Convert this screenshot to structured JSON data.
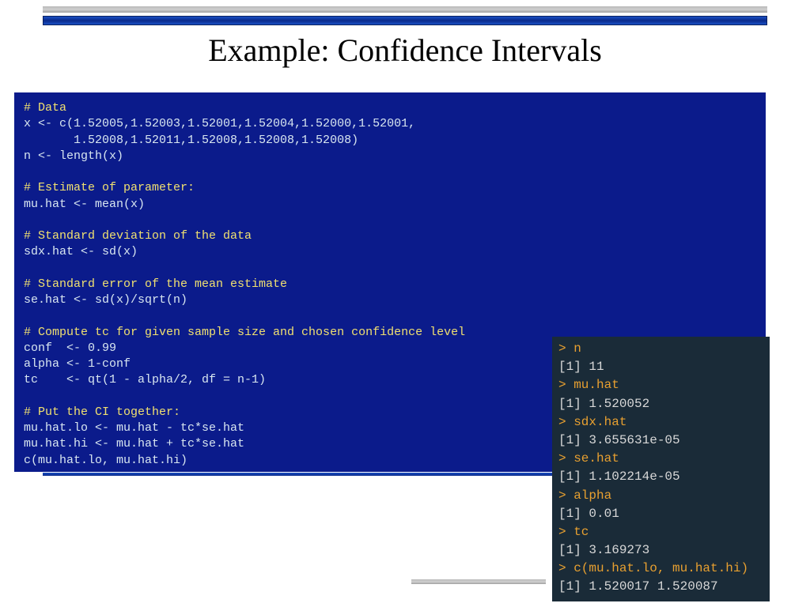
{
  "title": "Example: Confidence Intervals",
  "code": {
    "c1": "# Data",
    "l1": "x <- c(1.52005,1.52003,1.52001,1.52004,1.52000,1.52001,",
    "l2": "       1.52008,1.52011,1.52008,1.52008,1.52008)",
    "l3": "n <- length(x)",
    "c2": "# Estimate of parameter:",
    "l4": "mu.hat <- mean(x)",
    "c3": "# Standard deviation of the data",
    "l5": "sdx.hat <- sd(x)",
    "c4": "# Standard error of the mean estimate",
    "l6": "se.hat <- sd(x)/sqrt(n)",
    "c5": "# Compute tc for given sample size and chosen confidence level",
    "l7": "conf  <- 0.99",
    "l8": "alpha <- 1-conf",
    "l9": "tc    <- qt(1 - alpha/2, df = n-1)",
    "c6": "# Put the CI together:",
    "l10": "mu.hat.lo <- mu.hat - tc*se.hat",
    "l11": "mu.hat.hi <- mu.hat + tc*se.hat",
    "l12": "c(mu.hat.lo, mu.hat.hi)"
  },
  "console": {
    "p1": "> n",
    "o1": "[1] 11",
    "p2": "> mu.hat",
    "o2": "[1] 1.520052",
    "p3": "> sdx.hat",
    "o3": "[1] 3.655631e-05",
    "p4": "> se.hat",
    "o4": "[1] 1.102214e-05",
    "p5": "> alpha",
    "o5": "[1] 0.01",
    "p6": "> tc",
    "o6": "[1] 3.169273",
    "p7": "> c(mu.hat.lo, mu.hat.hi)",
    "o7": "[1] 1.520017 1.520087"
  }
}
